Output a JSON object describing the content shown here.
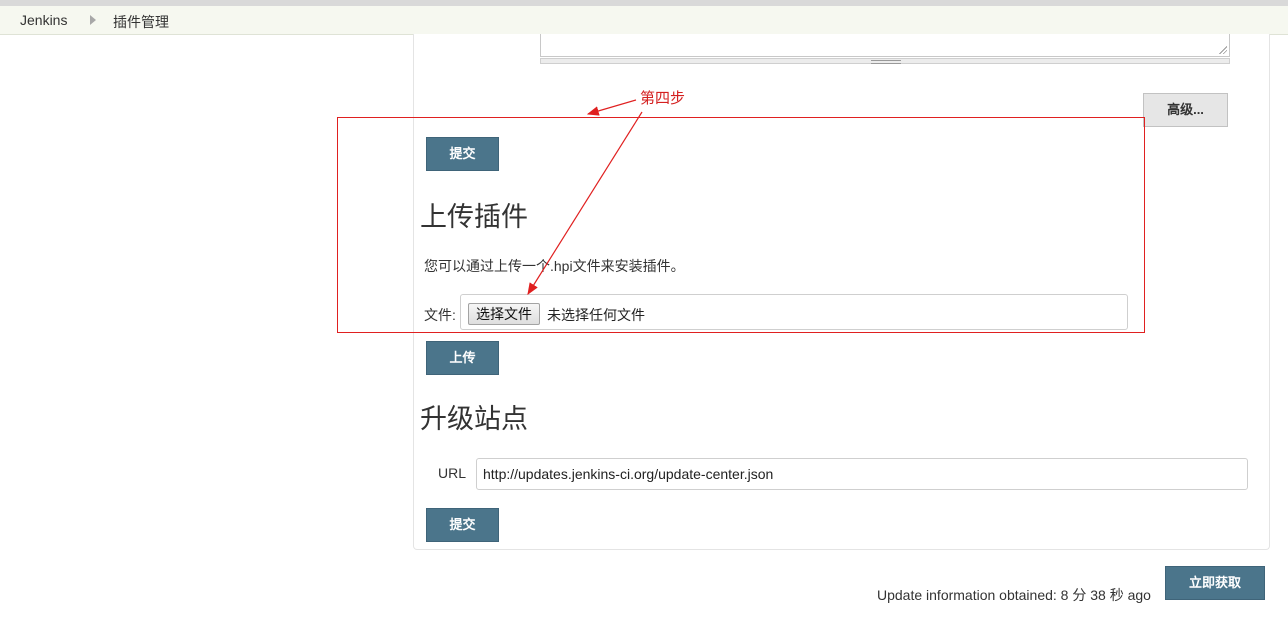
{
  "breadcrumb": {
    "root": "Jenkins",
    "current": "插件管理"
  },
  "advanced": {
    "button_label": "高级..."
  },
  "submit_top": {
    "label": "提交"
  },
  "upload": {
    "heading": "上传插件",
    "description": "您可以通过上传一个.hpi文件来安装插件。",
    "file_label": "文件:",
    "choose_file_label": "选择文件",
    "no_file_text": "未选择任何文件",
    "upload_button_label": "上传"
  },
  "update_site": {
    "heading": "升级站点",
    "url_label": "URL",
    "url_value": "http://updates.jenkins-ci.org/update-center.json",
    "submit_label": "提交"
  },
  "footer": {
    "update_info": "Update information obtained: 8 分 38 秒 ago",
    "check_now_label": "立即获取"
  },
  "annotation": {
    "text": "第四步",
    "color": "#e02020"
  },
  "colors": {
    "primary_button": "#4b758b",
    "breadcrumb_bg": "#f6f8f0"
  }
}
